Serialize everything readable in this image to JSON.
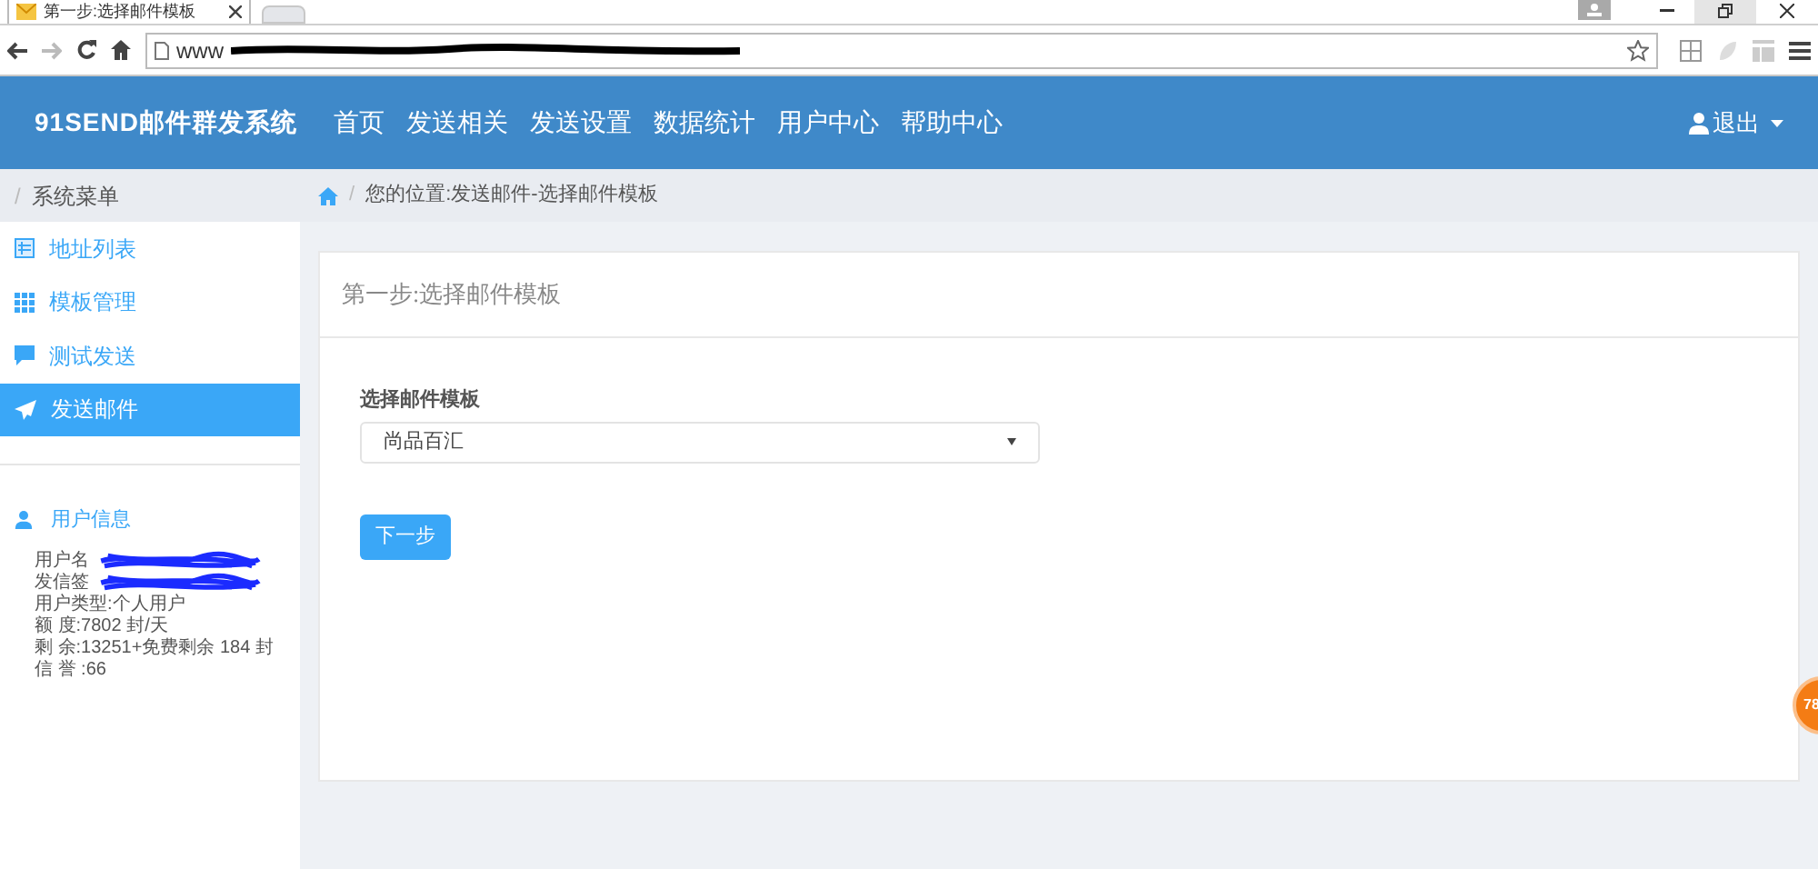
{
  "browser": {
    "tab_title": "第一步:选择邮件模板",
    "url": "www"
  },
  "navbar": {
    "brand": "91SEND邮件群发系统",
    "items": [
      {
        "label": "首页"
      },
      {
        "label": "发送相关"
      },
      {
        "label": "发送设置"
      },
      {
        "label": "数据统计"
      },
      {
        "label": "用户中心"
      },
      {
        "label": "帮助中心"
      }
    ],
    "user_menu": "退出"
  },
  "sidebar": {
    "header": "系统菜单",
    "items": [
      {
        "label": "地址列表",
        "kind": "list",
        "selected": false
      },
      {
        "label": "模板管理",
        "kind": "grid",
        "selected": false
      },
      {
        "label": "测试发送",
        "kind": "comment",
        "selected": false
      },
      {
        "label": "发送邮件",
        "kind": "send",
        "selected": true
      }
    ],
    "header_separator": "/",
    "user_info": {
      "title": "用户信息",
      "lines": [
        {
          "text": "用户名",
          "redacted": true
        },
        {
          "text": "发信签",
          "redacted": true
        },
        {
          "text": "用户类型:个人用户",
          "redacted": false
        },
        {
          "text": "额 度:7802 封/天",
          "redacted": false
        },
        {
          "text": "剩 余:13251+免费剩余 184 封",
          "redacted": false
        },
        {
          "text": "信 誉 :66",
          "redacted": false
        }
      ]
    }
  },
  "breadcrumb_separator": "/",
  "breadcrumb": "您的位置:发送邮件-选择邮件模板",
  "card": {
    "title": "第一步:选择邮件模板",
    "field_label": "选择邮件模板",
    "select_value": "尚品百汇",
    "button": "下一步"
  },
  "floating_badge": "78"
}
